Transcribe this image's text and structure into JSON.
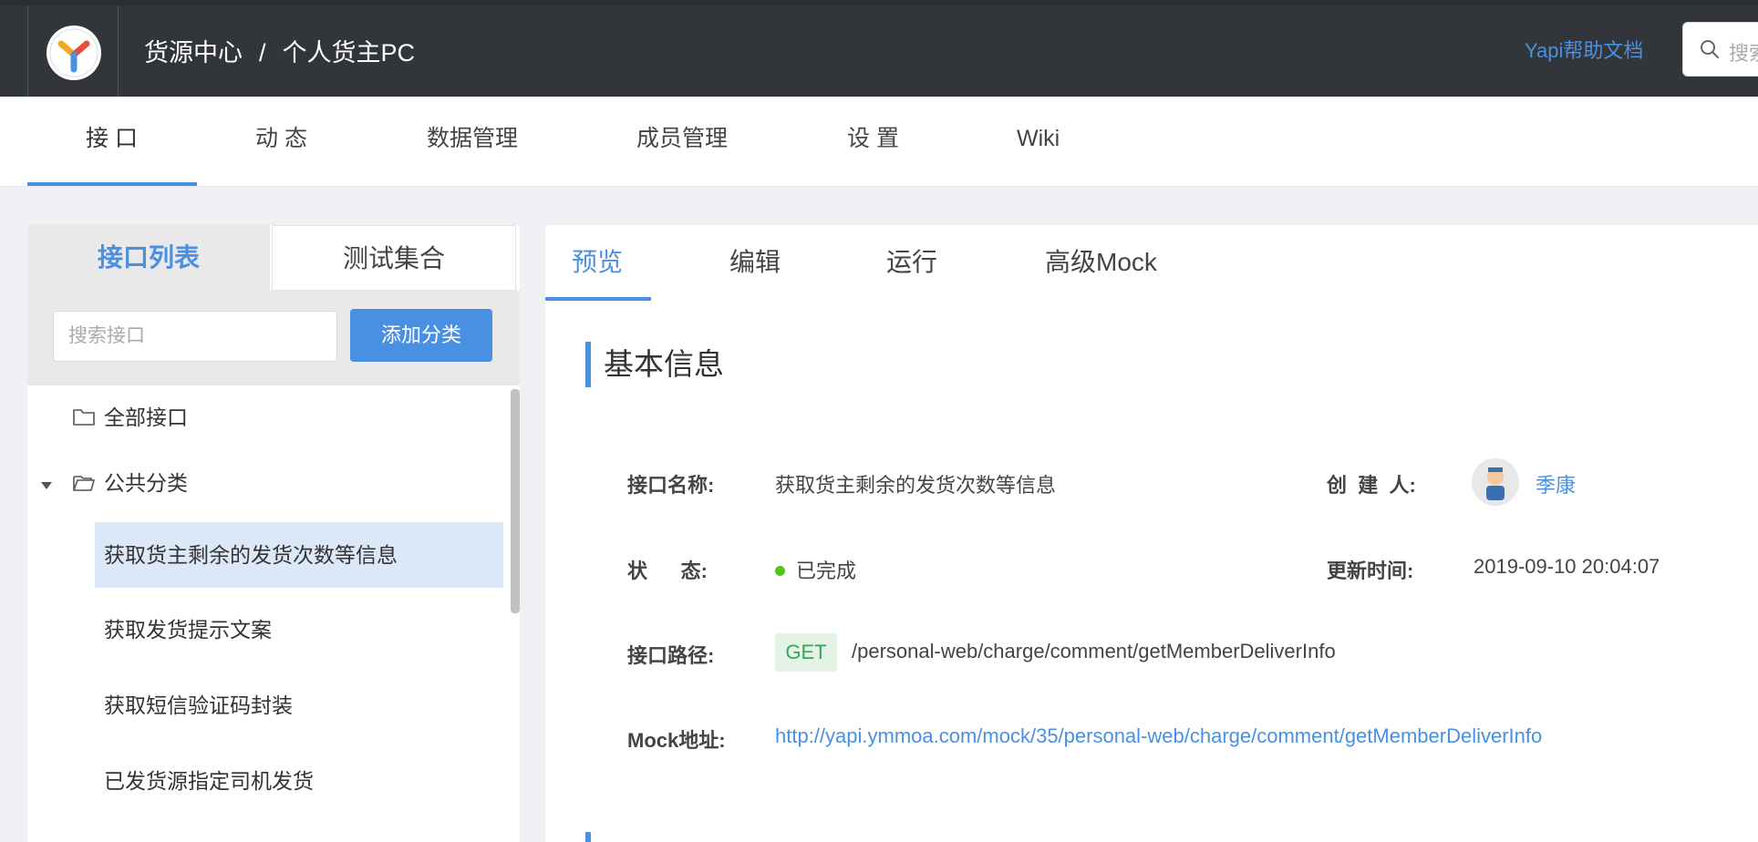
{
  "header": {
    "breadcrumb": [
      "货源中心",
      "个人货主PC"
    ],
    "breadcrumb_separator": "/",
    "help_link": "Yapi帮助文档",
    "search_placeholder": "搜索"
  },
  "nav": {
    "tabs": [
      "接 口",
      "动 态",
      "数据管理",
      "成员管理",
      "设 置",
      "Wiki"
    ],
    "active": "接 口"
  },
  "sidebar": {
    "tabs": [
      "接口列表",
      "测试集合"
    ],
    "active_tab": "接口列表",
    "search_placeholder": "搜索接口",
    "add_button": "添加分类",
    "tree": {
      "all": "全部接口",
      "category": "公共分类",
      "items": [
        "获取货主剩余的发货次数等信息",
        "获取发货提示文案",
        "获取短信验证码封装",
        "已发货源指定司机发货"
      ],
      "selected": "获取货主剩余的发货次数等信息"
    }
  },
  "detail": {
    "tabs": [
      "预览",
      "编辑",
      "运行",
      "高级Mock"
    ],
    "active_tab": "预览",
    "section_title": "基本信息",
    "fields": {
      "name_label": "接口名称:",
      "name_value": "获取货主剩余的发货次数等信息",
      "creator_label": "创  建  人:",
      "creator_value": "季康",
      "status_label": "状      态:",
      "status_value": "已完成",
      "updated_label": "更新时间:",
      "updated_value": "2019-09-10 20:04:07",
      "path_label": "接口路径:",
      "method": "GET",
      "path_value": "/personal-web/charge/comment/getMemberDeliverInfo",
      "mock_label": "Mock地址:",
      "mock_value": "http://yapi.ymmoa.com/mock/35/personal-web/charge/comment/getMemberDeliverInfo"
    }
  },
  "colors": {
    "accent": "#4a90e2",
    "header_bg": "#32363a",
    "status_done": "#52c41a",
    "method_get_bg": "#e3f4e7",
    "method_get_text": "#3aa35a"
  }
}
